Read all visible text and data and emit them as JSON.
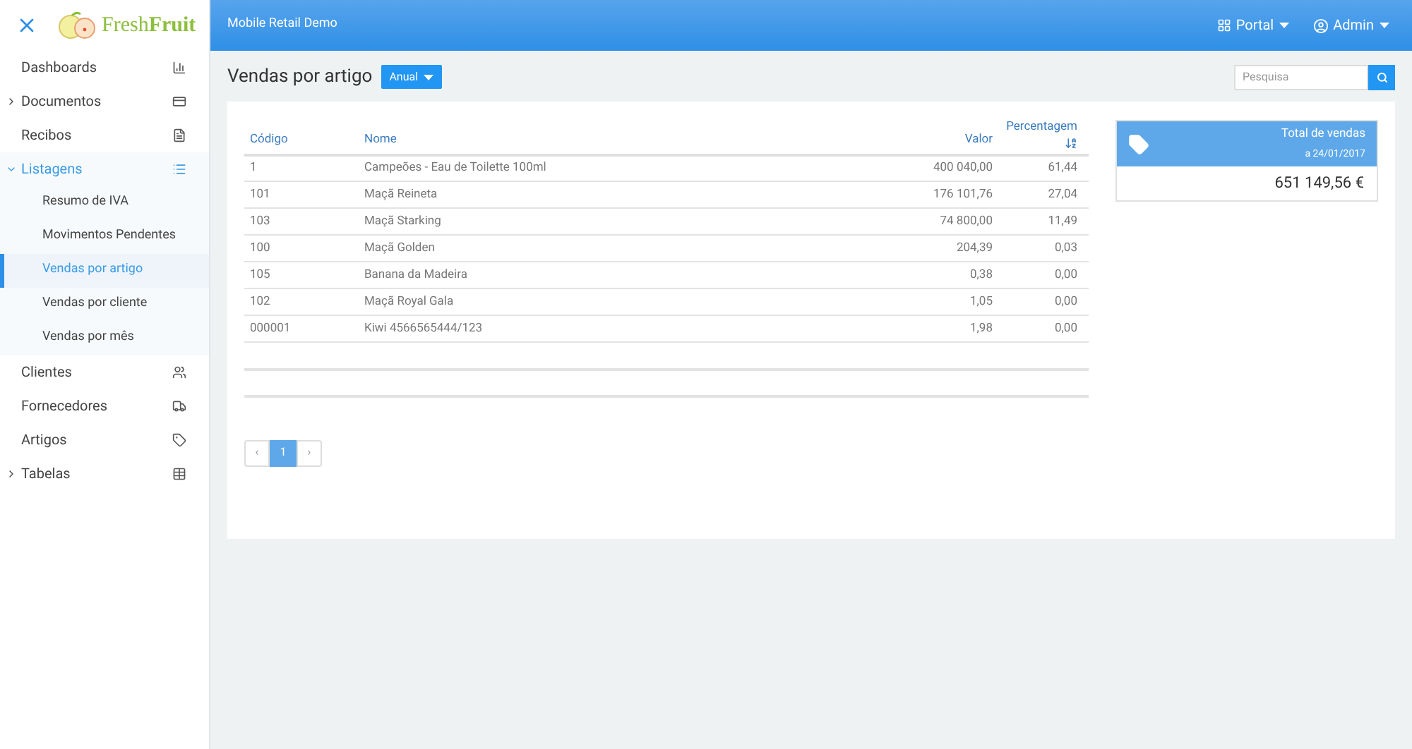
{
  "logo": {
    "text": "Fresh**Fruit**"
  },
  "header": {
    "title": "Mobile Retail Demo",
    "menus": [
      "Portal",
      "Admin"
    ]
  },
  "sidebar": {
    "items": [
      {
        "label": "Dashboards",
        "selected": false
      },
      {
        "label": "Documentos",
        "selected": false,
        "expanded": false
      },
      {
        "label": "Recibos",
        "selected": false
      },
      {
        "label": "Listagens",
        "selected": true,
        "expanded": true,
        "children": [
          {
            "label": "Resumo de IVA",
            "selected": false
          },
          {
            "label": "Movimentos Pendentes",
            "selected": false
          },
          {
            "label": "Vendas por artigo",
            "selected": true
          },
          {
            "label": "Vendas por cliente",
            "selected": false
          },
          {
            "label": "Vendas por mês",
            "selected": false
          }
        ]
      },
      {
        "label": "Clientes",
        "selected": false
      },
      {
        "label": "Fornecedores",
        "selected": false
      },
      {
        "label": "Artigos",
        "selected": false
      },
      {
        "label": "Tabelas",
        "selected": false,
        "expanded": false
      }
    ]
  },
  "page": {
    "title": "Vendas por artigo",
    "period_button": "Anual",
    "search": {
      "placeholder": "Pesquisa"
    }
  },
  "table": {
    "columns": [
      "Código",
      "Nome",
      "Valor",
      "Percentagem"
    ],
    "rows": [
      [
        "1",
        "Campeões - Eau de Toilette 100ml",
        "400 040,00",
        "61,44"
      ],
      [
        "101",
        "Maçã Reineta",
        "176 101,76",
        "27,04"
      ],
      [
        "103",
        "Maçã Starking",
        "74 800,00",
        "11,49"
      ],
      [
        "100",
        "Maçã Golden",
        "204,39",
        "0,03"
      ],
      [
        "105",
        "Banana da Madeira",
        "0,38",
        "0,00"
      ],
      [
        "102",
        "Maçã Royal Gala",
        "1,05",
        "0,00"
      ],
      [
        "000001",
        "Kiwi 4566565444/123",
        "1,98",
        "0,00"
      ]
    ]
  },
  "pagination": {
    "prev": "‹",
    "pages": [
      {
        "label": "1",
        "selected": true
      }
    ],
    "next": "›"
  },
  "total_card": {
    "title": "Total de vendas",
    "date": "a 24/01/2017",
    "value": "651 149,56 €"
  }
}
